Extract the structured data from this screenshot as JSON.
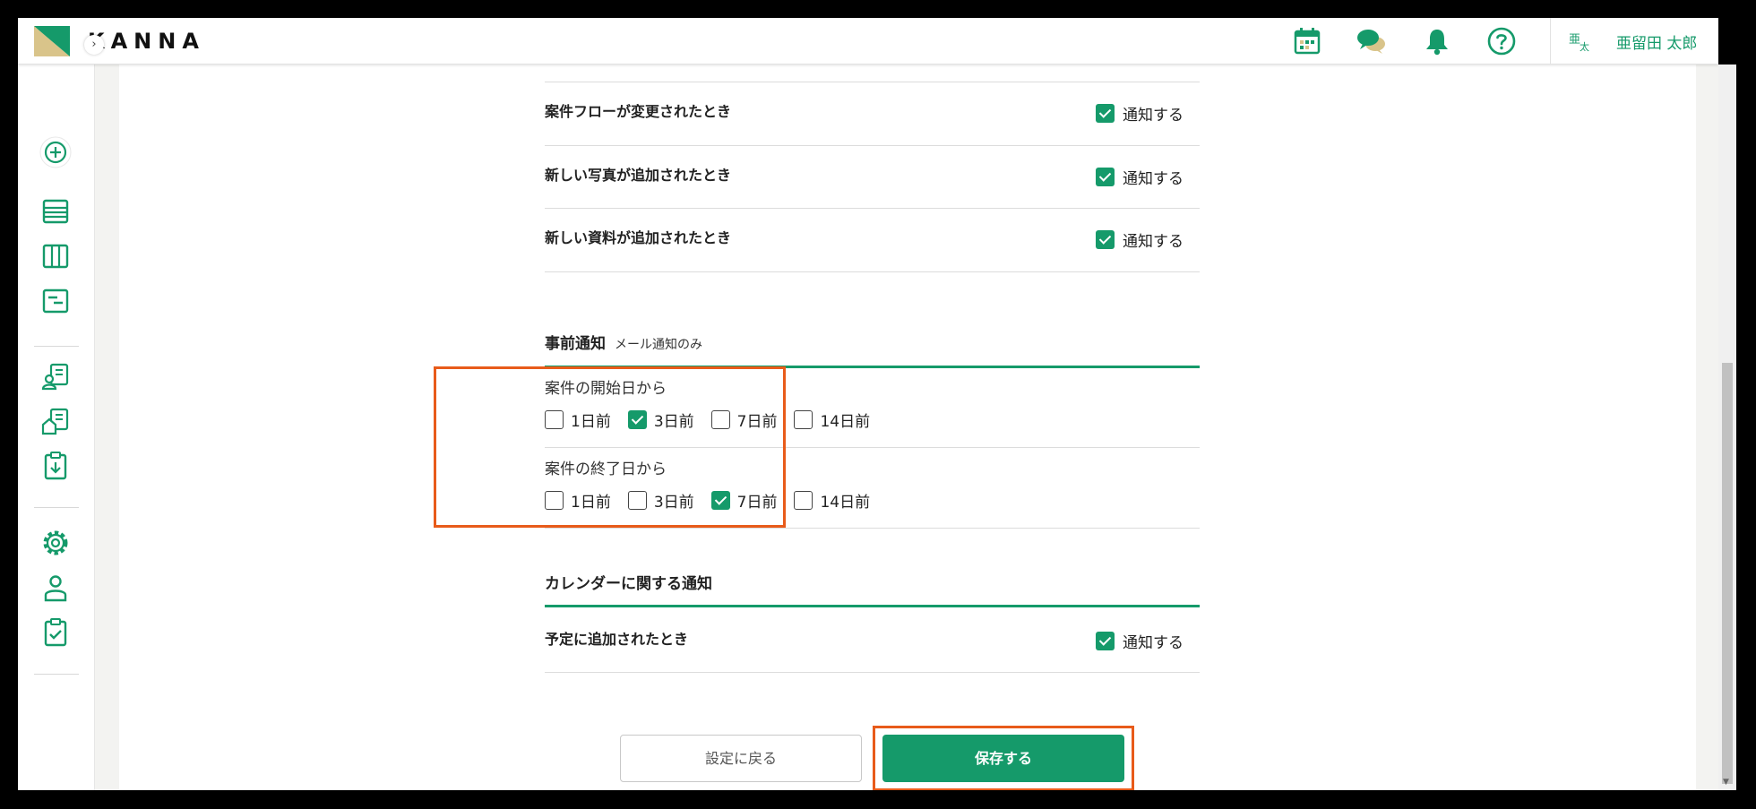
{
  "app": {
    "logo_text": "KANNA"
  },
  "header": {
    "avatar_text": [
      "亜",
      "太"
    ],
    "user_name": "亜留田 太郎"
  },
  "sidebar": {
    "collapse_glyph": "›"
  },
  "rows_top": [
    {
      "label": "案件フローが変更されたとき",
      "notify_label": "通知する",
      "checked": true
    },
    {
      "label": "新しい写真が追加されたとき",
      "notify_label": "通知する",
      "checked": true
    },
    {
      "label": "新しい資料が追加されたとき",
      "notify_label": "通知する",
      "checked": true
    }
  ],
  "advance": {
    "title": "事前通知",
    "subtitle": "メール通知のみ",
    "groups": [
      {
        "label": "案件の開始日から",
        "options": [
          {
            "label": "1日前",
            "checked": false
          },
          {
            "label": "3日前",
            "checked": true
          },
          {
            "label": "7日前",
            "checked": false
          },
          {
            "label": "14日前",
            "checked": false
          }
        ]
      },
      {
        "label": "案件の終了日から",
        "options": [
          {
            "label": "1日前",
            "checked": false
          },
          {
            "label": "3日前",
            "checked": false
          },
          {
            "label": "7日前",
            "checked": true
          },
          {
            "label": "14日前",
            "checked": false
          }
        ]
      }
    ]
  },
  "calendar": {
    "title": "カレンダーに関する通知",
    "rows": [
      {
        "label": "予定に追加されたとき",
        "notify_label": "通知する",
        "checked": true
      }
    ]
  },
  "buttons": {
    "back_label": "設定に戻る",
    "save_label": "保存する"
  },
  "colors": {
    "accent": "#159a6a",
    "highlight": "#e85b1a"
  }
}
